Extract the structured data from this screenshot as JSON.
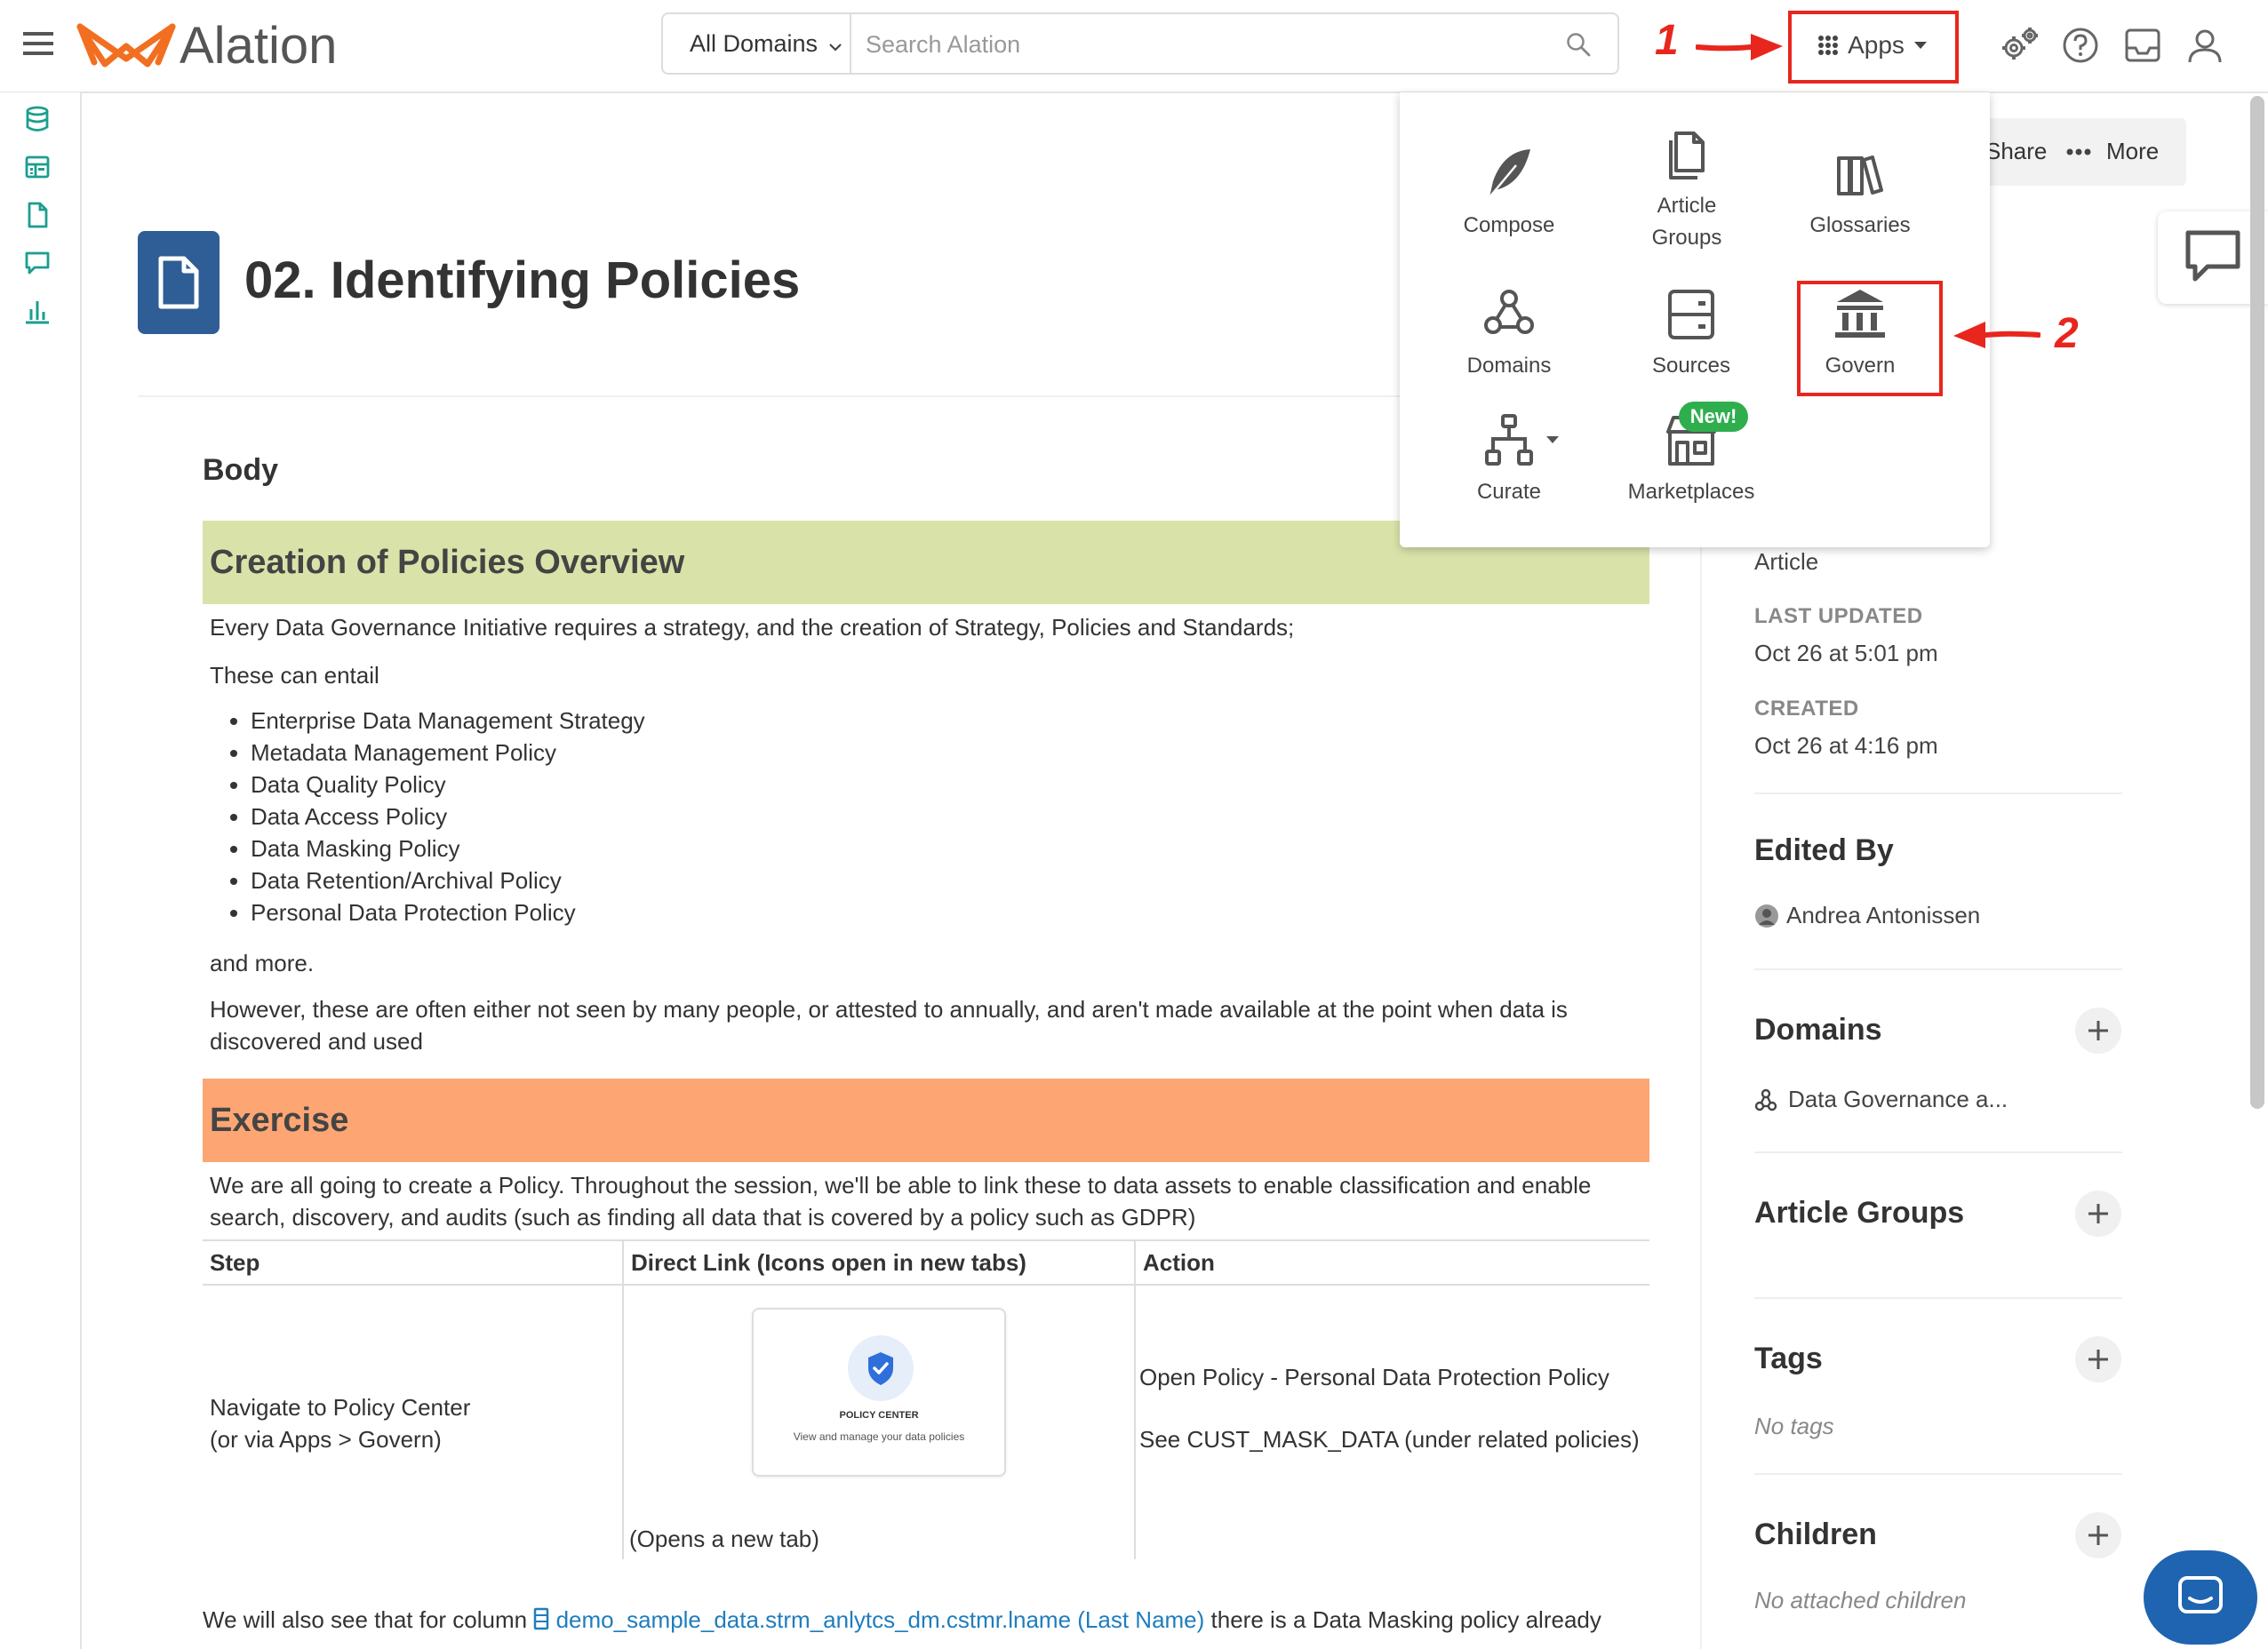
{
  "header": {
    "logo_text": "Alation",
    "domains_select": "All Domains",
    "search_placeholder": "Search Alation",
    "apps_label": "Apps"
  },
  "apps_menu": {
    "items": [
      {
        "label": "Compose",
        "icon": "feather-icon"
      },
      {
        "label": "Article Groups",
        "icon": "documents-icon"
      },
      {
        "label": "Glossaries",
        "icon": "books-icon"
      },
      {
        "label": "Domains",
        "icon": "domains-icon"
      },
      {
        "label": "Sources",
        "icon": "server-icon"
      },
      {
        "label": "Govern",
        "icon": "bank-icon"
      },
      {
        "label": "Curate",
        "icon": "hierarchy-icon"
      },
      {
        "label": "Marketplaces",
        "icon": "store-icon"
      }
    ],
    "new_badge": "New!"
  },
  "annotations": {
    "step1": "1",
    "step2": "2",
    "color": "#e8261d"
  },
  "article": {
    "title": "02. Identifying Policies",
    "body_heading": "Body",
    "section1_title": "Creation of Policies Overview",
    "para1": "Every Data Governance Initiative requires a strategy, and the creation of Strategy, Policies and Standards;",
    "para2": "These can entail",
    "bullets": [
      "Enterprise Data Management Strategy",
      "Metadata Management Policy",
      "Data Quality Policy",
      "Data Access Policy",
      "Data Masking Policy",
      "Data Retention/Archival Policy",
      "Personal Data Protection Policy"
    ],
    "para3": "and more.",
    "para4": "However, these are often either not seen by many people, or attested to annually, and aren't made available at the point when data is discovered and used",
    "section2_title": "Exercise",
    "para5": "We are all going to create a Policy. Throughout the session, we'll be able to link these to data assets to enable classification and enable search, discovery, and audits (such as finding all data that is covered by a policy such as GDPR)",
    "table": {
      "headers": [
        "Step",
        "Direct Link (Icons open in new tabs)",
        "Action"
      ],
      "step_line1": "Navigate to Policy Center",
      "step_line2": "(or via Apps > Govern)",
      "card_title": "POLICY CENTER",
      "card_subtitle": "View and manage your data policies",
      "link_note": "(Opens a new tab)",
      "action_line1": "Open Policy -  Personal Data Protection Policy",
      "action_line2": "See CUST_MASK_DATA (under related policies)"
    },
    "bottom_prefix": "We will also see that for column ",
    "bottom_link": "demo_sample_data.strm_anlytcs_dm.cstmr.lname (Last Name)",
    "bottom_suffix": " there is a Data Masking policy already"
  },
  "sidebar": {
    "share_label": "Share",
    "more_label": "More",
    "type_value": "Article",
    "last_updated_label": "LAST UPDATED",
    "last_updated_value": "Oct 26 at 5:01 pm",
    "created_label": "CREATED",
    "created_value": "Oct 26 at 4:16 pm",
    "edited_by_heading": "Edited By",
    "editor_name": "Andrea Antonissen",
    "domains_heading": "Domains",
    "domain_value": "Data Governance a...",
    "article_groups_heading": "Article Groups",
    "tags_heading": "Tags",
    "tags_empty": "No tags",
    "children_heading": "Children",
    "children_empty": "No attached children"
  },
  "colors": {
    "accent_teal": "#1a9e8f",
    "doc_icon_blue": "#2f5d96",
    "link_blue": "#1f7dbd",
    "green_banner": "#d9e3a9",
    "orange_banner": "#fda673",
    "new_badge": "#2fae4e"
  }
}
